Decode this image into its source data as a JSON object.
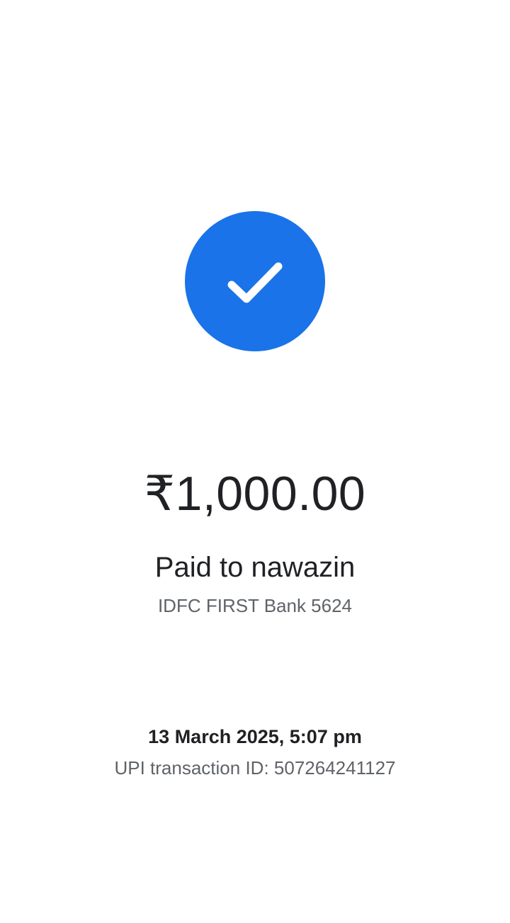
{
  "status": {
    "icon": "check-circle-icon",
    "accent_color": "#1a73e8"
  },
  "payment": {
    "amount": "₹1,000.00",
    "paid_to": "Paid to nawazin",
    "bank": "IDFC FIRST Bank 5624"
  },
  "transaction": {
    "datetime": "13 March 2025, 5:07 pm",
    "upi_id": "UPI transaction ID: 507264241127"
  }
}
